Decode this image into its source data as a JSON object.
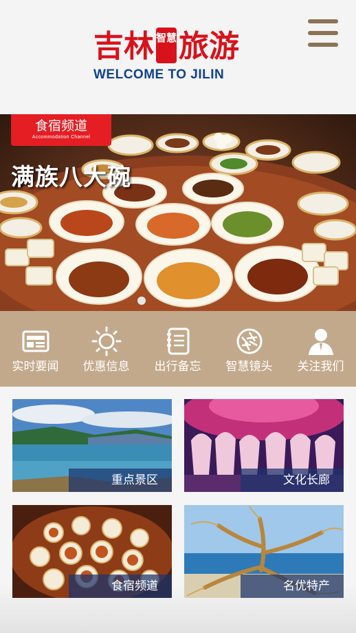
{
  "header": {
    "logo_cn_main": "吉林",
    "logo_cn_seal": "智慧",
    "logo_cn_tail": "旅游",
    "logo_en": "WELCOME TO JILIN",
    "menu_icon": "hamburger-menu-icon"
  },
  "banner": {
    "tag_cn": "食宿频道",
    "tag_en": "Accommodation Channel",
    "caption": "满族八大碗",
    "active_slide": 1,
    "slide_count": 1
  },
  "nav": {
    "items": [
      {
        "label": "实时要闻",
        "icon": "newspaper-icon"
      },
      {
        "label": "优惠信息",
        "icon": "sun-icon"
      },
      {
        "label": "出行备忘",
        "icon": "notebook-icon"
      },
      {
        "label": "智慧镜头",
        "icon": "camera-shutter-icon"
      },
      {
        "label": "关注我们",
        "icon": "user-icon"
      }
    ]
  },
  "tiles": [
    {
      "label": "重点景区"
    },
    {
      "label": "文化长廊"
    },
    {
      "label": "食宿频道"
    },
    {
      "label": "名优特产"
    }
  ],
  "colors": {
    "brand_red": "#d8121c",
    "brand_blue": "#12428c",
    "nav_bg": "#c3a98c",
    "menu_icon": "#8b7356",
    "tile_label_bg": "#1c346e"
  }
}
